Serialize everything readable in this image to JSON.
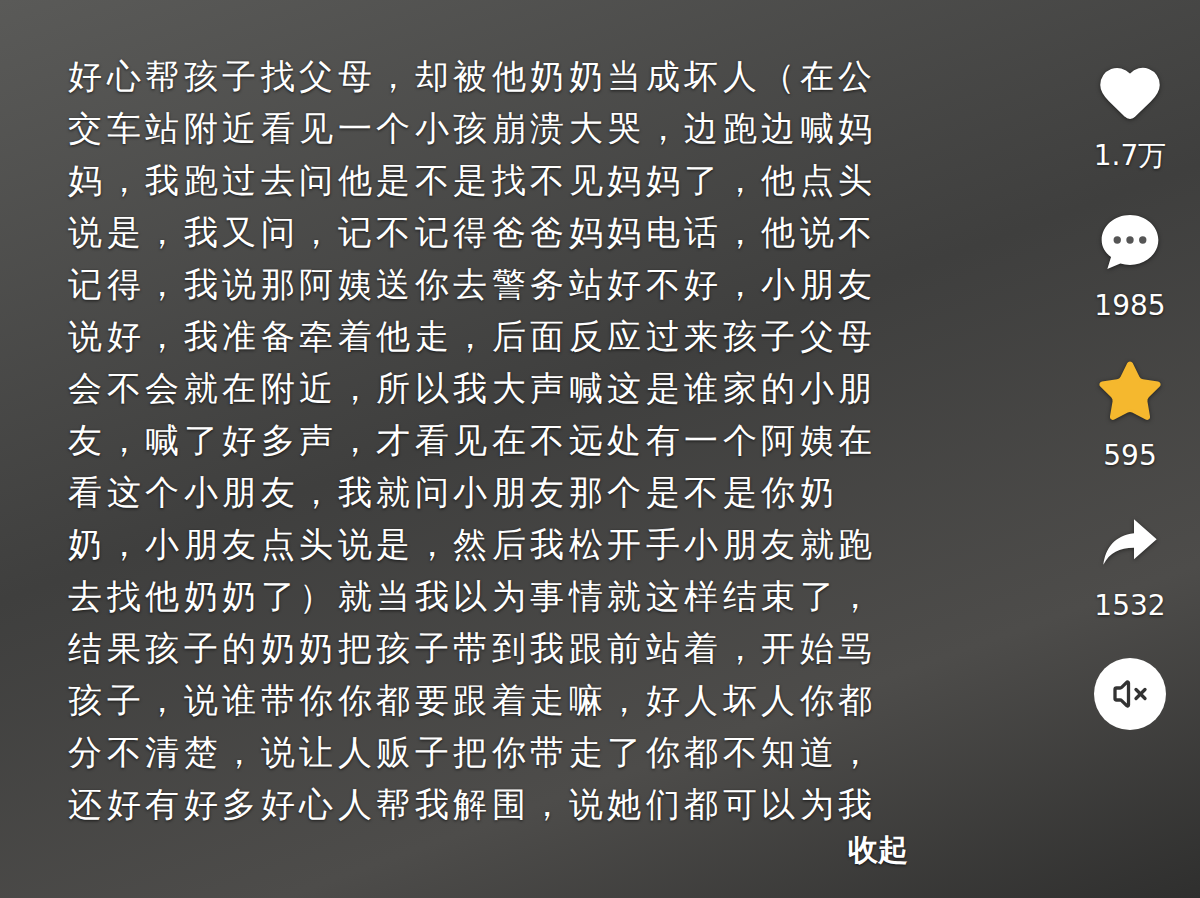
{
  "caption": {
    "lines": [
      "好心帮孩子找父母，却被他奶奶当成坏人（在公",
      "交车站附近看见一个小孩崩溃大哭，边跑边喊妈",
      "妈，我跑过去问他是不是找不见妈妈了，他点头",
      "说是，我又问，记不记得爸爸妈妈电话，他说不",
      "记得，我说那阿姨送你去警务站好不好，小朋友",
      "说好，我准备牵着他走，后面反应过来孩子父母",
      "会不会就在附近，所以我大声喊这是谁家的小朋",
      "友，喊了好多声，才看见在不远处有一个阿姨在",
      "看这个小朋友，我就问小朋友那个是不是你奶",
      "奶，小朋友点头说是，然后我松开手小朋友就跑",
      "去找他奶奶了）就当我以为事情就这样结束了，",
      "结果孩子的奶奶把孩子带到我跟前站着，开始骂",
      "孩子，说谁带你你都要跟着走嘛，好人坏人你都",
      "分不清楚，说让人贩子把你带走了你都不知道，",
      "还好有好多好心人帮我解围，说她们都可以为我"
    ],
    "collapse": "收起"
  },
  "actions": [
    {
      "kind": "like",
      "count": "1.7万",
      "selected": false
    },
    {
      "kind": "comment",
      "count": "1985",
      "selected": false
    },
    {
      "kind": "favorite",
      "count": "595",
      "selected": true,
      "color": "#f5b82e"
    },
    {
      "kind": "share",
      "count": "1532",
      "selected": false
    }
  ],
  "sound": {
    "muted": true
  }
}
